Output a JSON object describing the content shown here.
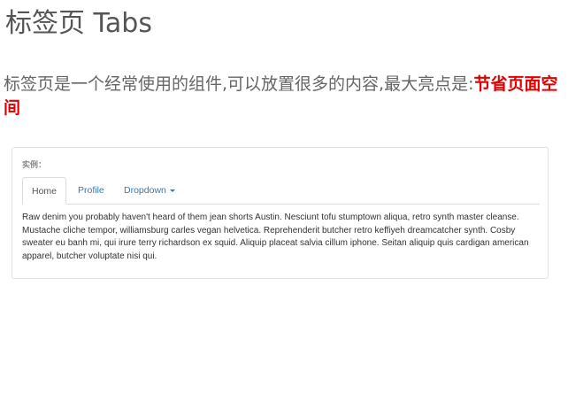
{
  "page": {
    "title": "标签页 Tabs"
  },
  "intro": {
    "text": "标签页是一个经常使用的组件,可以放置很多的内容,最大亮点是:",
    "highlight": "节省页面空间"
  },
  "example": {
    "label": "实例：",
    "tabs": [
      {
        "label": "Home",
        "active": true
      },
      {
        "label": "Profile",
        "active": false
      },
      {
        "label": "Dropdown",
        "active": false
      }
    ],
    "content": "Raw denim you probably haven't heard of them jean shorts Austin. Nesciunt tofu stumptown aliqua, retro synth master cleanse. Mustache cliche tempor, williamsburg carles vegan helvetica. Reprehenderit butcher retro keffiyeh dreamcatcher synth. Cosby sweater eu banh mi, qui irure terry richardson ex squid. Aliquip placeat salvia cillum iphone. Seitan aliquip quis cardigan american apparel, butcher voluptate nisi qui."
  },
  "colors": {
    "highlight": "#e00000",
    "link": "#337ab7",
    "title": "#555555"
  },
  "icons": {
    "dropdown_caret": "caret-down-icon"
  }
}
